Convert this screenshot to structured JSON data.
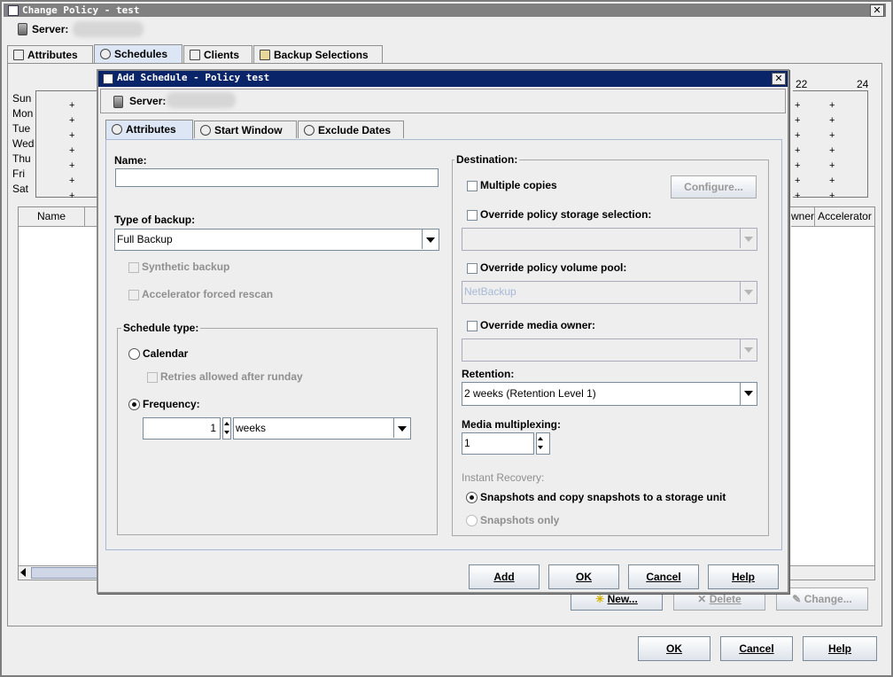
{
  "outer": {
    "title": "Change Policy - test",
    "server_label": "Server:",
    "tabs": [
      {
        "label": "Attributes",
        "icon": "list-icon"
      },
      {
        "label": "Schedules",
        "icon": "clock-icon"
      },
      {
        "label": "Clients",
        "icon": "client-icon"
      },
      {
        "label": "Backup Selections",
        "icon": "book-icon"
      }
    ],
    "calendar": {
      "days": [
        "Sun",
        "Mon",
        "Tue",
        "Wed",
        "Thu",
        "Fri",
        "Sat"
      ],
      "hour_labels": [
        "22",
        "24"
      ]
    },
    "table_headers": {
      "name": "Name",
      "owner_partial": "wner",
      "accelerator": "Accelerator"
    },
    "buttons": {
      "new": "New...",
      "delete": "Delete",
      "change": "Change...",
      "ok": "OK",
      "cancel": "Cancel",
      "help": "Help"
    }
  },
  "dialog": {
    "title": "Add Schedule - Policy test",
    "server_label": "Server:",
    "tabs": [
      {
        "label": "Attributes",
        "icon": "clock-icon"
      },
      {
        "label": "Start Window",
        "icon": "clock-icon"
      },
      {
        "label": "Exclude Dates",
        "icon": "calendar-icon"
      }
    ],
    "name_label": "Name:",
    "name_value": "",
    "type_of_backup_label": "Type of backup:",
    "type_of_backup_value": "Full Backup",
    "synthetic_backup": "Synthetic backup",
    "accelerator_forced_rescan": "Accelerator forced rescan",
    "schedule_type": {
      "title": "Schedule type:",
      "calendar": "Calendar",
      "retries": "Retries allowed after runday",
      "frequency": "Frequency:",
      "frequency_value": "1",
      "frequency_unit": "weeks",
      "selected": "Frequency"
    },
    "destination": {
      "title": "Destination:",
      "multiple_copies": "Multiple copies",
      "configure": "Configure...",
      "override_storage": "Override policy storage selection:",
      "storage_value": "",
      "override_volume_pool": "Override policy volume pool:",
      "volume_pool_value": "NetBackup",
      "override_media_owner": "Override media owner:",
      "media_owner_value": "",
      "retention_label": "Retention:",
      "retention_value": "2 weeks (Retention Level 1)",
      "multiplexing_label": "Media multiplexing:",
      "multiplexing_value": "1",
      "instant_recovery_label": "Instant Recovery:",
      "snapshots_copy": "Snapshots and copy snapshots to a storage unit",
      "snapshots_only": "Snapshots only"
    },
    "buttons": {
      "add": "Add",
      "ok": "OK",
      "cancel": "Cancel",
      "help": "Help"
    }
  },
  "colors": {
    "dialog_title_bg": "#0a246a",
    "selected_tab": "#dce6f4",
    "window_bg": "#eeeeee"
  }
}
